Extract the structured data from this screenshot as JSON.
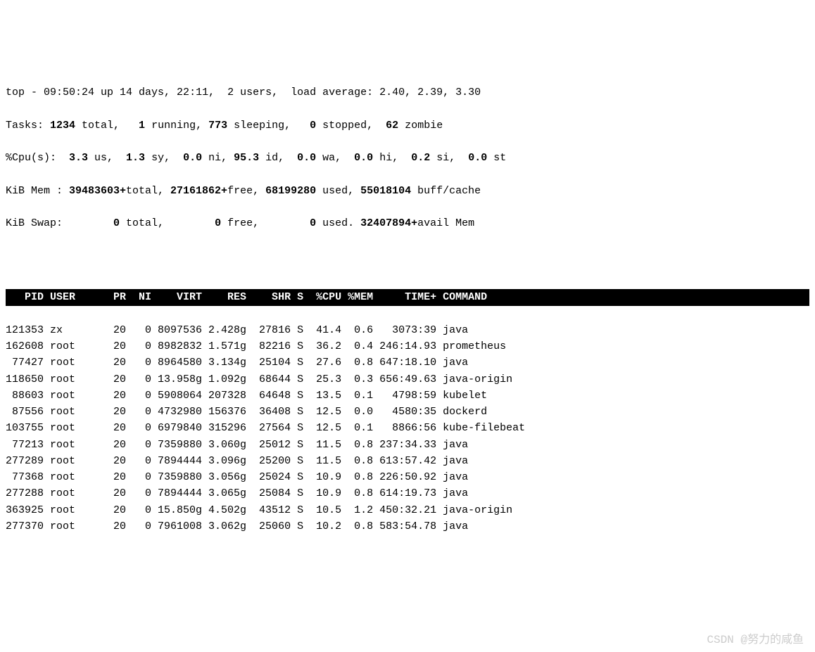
{
  "summary": {
    "line1": {
      "prefix": "top - ",
      "time": "09:50:24",
      "mid1": " up ",
      "up": "14 days, 22:11",
      "mid2": ",  ",
      "users": "2 users",
      "mid3": ",  load average: ",
      "load": "2.40, 2.39, 3.30"
    },
    "line2": {
      "prefix": "Tasks: ",
      "total": "1234",
      "t1": " total,   ",
      "running": "1",
      "t2": " running, ",
      "sleeping": "773",
      "t3": " sleeping,   ",
      "stopped": "0",
      "t4": " stopped,  ",
      "zombie": "62",
      "t5": " zombie"
    },
    "line3": {
      "prefix": "%Cpu(s):  ",
      "us": "3.3",
      "t1": " us,  ",
      "sy": "1.3",
      "t2": " sy,  ",
      "ni": "0.0",
      "t3": " ni, ",
      "id": "95.3",
      "t4": " id,  ",
      "wa": "0.0",
      "t5": " wa,  ",
      "hi": "0.0",
      "t6": " hi,  ",
      "si": "0.2",
      "t7": " si,  ",
      "st": "0.0",
      "t8": " st"
    },
    "line4": {
      "prefix": "KiB Mem : ",
      "total": "39483603+",
      "t1": "total, ",
      "free": "27161862+",
      "t2": "free, ",
      "used": "68199280",
      "t3": " used, ",
      "buff": "55018104",
      "t4": " buff/cache"
    },
    "line5": {
      "prefix": "KiB Swap:        ",
      "total": "0",
      "t1": " total,        ",
      "free": "0",
      "t2": " free,        ",
      "used": "0",
      "t3": " used. ",
      "avail": "32407894+",
      "t4": "avail Mem "
    }
  },
  "header": "   PID USER      PR  NI    VIRT    RES    SHR S  %CPU %MEM     TIME+ COMMAND         ",
  "rows": [
    "121353 zx        20   0 8097536 2.428g  27816 S  41.4  0.6   3073:39 java",
    "162608 root      20   0 8982832 1.571g  82216 S  36.2  0.4 246:14.93 prometheus",
    " 77427 root      20   0 8964580 3.134g  25104 S  27.6  0.8 647:18.10 java",
    "118650 root      20   0 13.958g 1.092g  68644 S  25.3  0.3 656:49.63 java-origin",
    " 88603 root      20   0 5908064 207328  64648 S  13.5  0.1   4798:59 kubelet",
    " 87556 root      20   0 4732980 156376  36408 S  12.5  0.0   4580:35 dockerd",
    "103755 root      20   0 6979840 315296  27564 S  12.5  0.1   8866:56 kube-filebeat",
    " 77213 root      20   0 7359880 3.060g  25012 S  11.5  0.8 237:34.33 java",
    "277289 root      20   0 7894444 3.096g  25200 S  11.5  0.8 613:57.42 java",
    " 77368 root      20   0 7359880 3.056g  25024 S  10.9  0.8 226:50.92 java",
    "277288 root      20   0 7894444 3.065g  25084 S  10.9  0.8 614:19.73 java",
    "363925 root      20   0 15.850g 4.502g  43512 S  10.5  1.2 450:32.21 java-origin",
    "277370 root      20   0 7961008 3.062g  25060 S  10.2  0.8 583:54.78 java"
  ],
  "watermark": "CSDN @努力的咸鱼"
}
